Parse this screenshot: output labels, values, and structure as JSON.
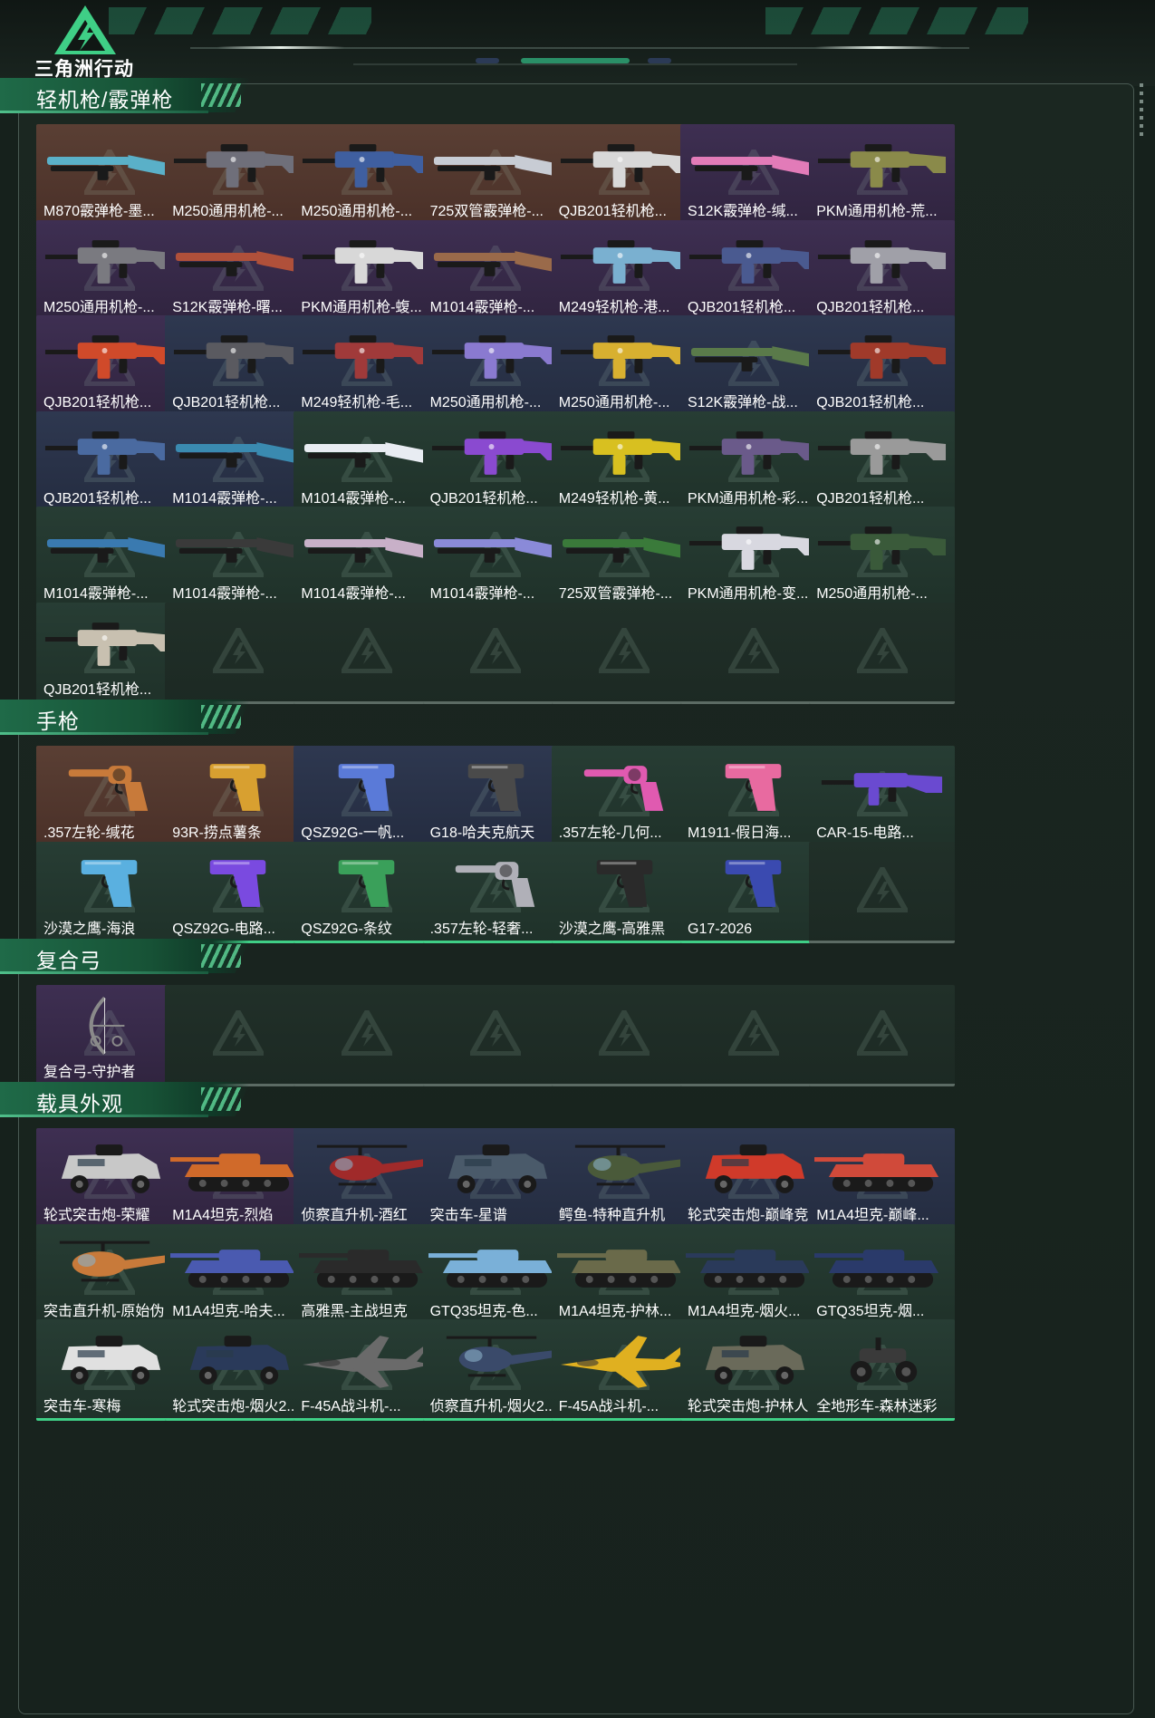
{
  "header": {
    "logo_text": "三角洲行动"
  },
  "sections": [
    {
      "title": "轻机枪/霰弹枪",
      "items": [
        {
          "name": "M870霰弹枪-墨...",
          "rarity": "orange",
          "icon": "shotgun-icon",
          "color": "#5ab0c8"
        },
        {
          "name": "M250通用机枪-...",
          "rarity": "orange",
          "icon": "machine-gun-icon",
          "color": "#6f6f7a"
        },
        {
          "name": "M250通用机枪-...",
          "rarity": "orange",
          "icon": "machine-gun-icon",
          "color": "#3f5fa0"
        },
        {
          "name": "725双管霰弹枪-...",
          "rarity": "orange",
          "icon": "shotgun-icon",
          "color": "#c8ccd4"
        },
        {
          "name": "QJB201轻机枪...",
          "rarity": "orange",
          "icon": "machine-gun-icon",
          "color": "#d8d8d8"
        },
        {
          "name": "S12K霰弹枪-缄...",
          "rarity": "purple",
          "icon": "shotgun-icon",
          "color": "#e27bb8"
        },
        {
          "name": "PKM通用机枪-荒...",
          "rarity": "purple",
          "icon": "machine-gun-icon",
          "color": "#8a8a4a"
        },
        {
          "name": "M250通用机枪-...",
          "rarity": "purple",
          "icon": "machine-gun-icon",
          "color": "#7a7a80"
        },
        {
          "name": "S12K霰弹枪-曙...",
          "rarity": "purple",
          "icon": "shotgun-icon",
          "color": "#b0503a"
        },
        {
          "name": "PKM通用机枪-蝮...",
          "rarity": "purple",
          "icon": "machine-gun-icon",
          "color": "#d8d8d8"
        },
        {
          "name": "M1014霰弹枪-...",
          "rarity": "purple",
          "icon": "shotgun-icon",
          "color": "#9a6a4a"
        },
        {
          "name": "M249轻机枪-港...",
          "rarity": "purple",
          "icon": "machine-gun-icon",
          "color": "#7ab0d0"
        },
        {
          "name": "QJB201轻机枪...",
          "rarity": "purple",
          "icon": "machine-gun-icon",
          "color": "#4a5a90"
        },
        {
          "name": "QJB201轻机枪...",
          "rarity": "purple",
          "icon": "machine-gun-icon",
          "color": "#a0a0a8"
        },
        {
          "name": "QJB201轻机枪...",
          "rarity": "purple",
          "icon": "machine-gun-icon",
          "color": "#d04a2a"
        },
        {
          "name": "QJB201轻机枪...",
          "rarity": "blue",
          "icon": "machine-gun-icon",
          "color": "#5a5a60"
        },
        {
          "name": "M249轻机枪-毛...",
          "rarity": "blue",
          "icon": "machine-gun-icon",
          "color": "#a03a3a"
        },
        {
          "name": "M250通用机枪-...",
          "rarity": "blue",
          "icon": "machine-gun-icon",
          "color": "#8a7ad0"
        },
        {
          "name": "M250通用机枪-...",
          "rarity": "blue",
          "icon": "machine-gun-icon",
          "color": "#d8b030"
        },
        {
          "name": "S12K霰弹枪-战...",
          "rarity": "blue",
          "icon": "shotgun-icon",
          "color": "#5a7a4a"
        },
        {
          "name": "QJB201轻机枪...",
          "rarity": "blue",
          "icon": "machine-gun-icon",
          "color": "#a03a2a"
        },
        {
          "name": "QJB201轻机枪...",
          "rarity": "blue",
          "icon": "machine-gun-icon",
          "color": "#4a6aa0"
        },
        {
          "name": "M1014霰弹枪-...",
          "rarity": "blue",
          "icon": "shotgun-icon",
          "color": "#3a8ab0"
        },
        {
          "name": "M1014霰弹枪-...",
          "rarity": "green",
          "icon": "shotgun-icon",
          "color": "#e8ecf2"
        },
        {
          "name": "QJB201轻机枪...",
          "rarity": "green",
          "icon": "machine-gun-icon",
          "color": "#8a4ad0"
        },
        {
          "name": "M249轻机枪-黄...",
          "rarity": "green",
          "icon": "machine-gun-icon",
          "color": "#d8c020"
        },
        {
          "name": "PKM通用机枪-彩...",
          "rarity": "green",
          "icon": "machine-gun-icon",
          "color": "#6a5a8a"
        },
        {
          "name": "QJB201轻机枪...",
          "rarity": "green",
          "icon": "machine-gun-icon",
          "color": "#9a9a9a"
        },
        {
          "name": "M1014霰弹枪-...",
          "rarity": "green",
          "icon": "shotgun-icon",
          "color": "#3a7ab0"
        },
        {
          "name": "M1014霰弹枪-...",
          "rarity": "green",
          "icon": "shotgun-icon",
          "color": "#3a3a3a"
        },
        {
          "name": "M1014霰弹枪-...",
          "rarity": "green",
          "icon": "shotgun-icon",
          "color": "#c8b0c8"
        },
        {
          "name": "M1014霰弹枪-...",
          "rarity": "green",
          "icon": "shotgun-icon",
          "color": "#8a8ad8"
        },
        {
          "name": "725双管霰弹枪-...",
          "rarity": "green",
          "icon": "shotgun-icon",
          "color": "#3a7a3a"
        },
        {
          "name": "PKM通用机枪-变...",
          "rarity": "green",
          "icon": "machine-gun-icon",
          "color": "#d8d8e0"
        },
        {
          "name": "M250通用机枪-...",
          "rarity": "green",
          "icon": "machine-gun-icon",
          "color": "#3a5a3a"
        },
        {
          "name": "QJB201轻机枪...",
          "rarity": "green",
          "icon": "machine-gun-icon",
          "color": "#c8c0b0"
        },
        {
          "name": "",
          "rarity": "empty"
        },
        {
          "name": "",
          "rarity": "empty"
        },
        {
          "name": "",
          "rarity": "empty"
        },
        {
          "name": "",
          "rarity": "empty"
        },
        {
          "name": "",
          "rarity": "empty"
        },
        {
          "name": "",
          "rarity": "empty"
        }
      ]
    },
    {
      "title": "手枪",
      "items": [
        {
          "name": ".357左轮-缄花",
          "rarity": "orange",
          "icon": "revolver-icon",
          "color": "#c87a3a"
        },
        {
          "name": "93R-捞点薯条",
          "rarity": "orange",
          "icon": "pistol-icon",
          "color": "#d8a030"
        },
        {
          "name": "QSZ92G-一帆...",
          "rarity": "blue",
          "icon": "pistol-icon",
          "color": "#5a7ad8"
        },
        {
          "name": "G18-哈夫克航天",
          "rarity": "blue",
          "icon": "pistol-icon",
          "color": "#4a4a4a"
        },
        {
          "name": ".357左轮-几何...",
          "rarity": "green",
          "icon": "revolver-icon",
          "color": "#e05ab0"
        },
        {
          "name": "M1911-假日海...",
          "rarity": "green",
          "icon": "pistol-icon",
          "color": "#e86aa0"
        },
        {
          "name": "CAR-15-电路...",
          "rarity": "green",
          "icon": "rifle-icon",
          "color": "#6a4ad0"
        },
        {
          "name": "沙漠之鹰-海浪",
          "rarity": "green",
          "icon": "pistol-icon",
          "color": "#5ab0e0"
        },
        {
          "name": "QSZ92G-电路...",
          "rarity": "green",
          "icon": "pistol-icon",
          "color": "#7a4ae0"
        },
        {
          "name": "QSZ92G-条纹",
          "rarity": "green",
          "icon": "pistol-icon",
          "color": "#3aa05a"
        },
        {
          "name": ".357左轮-轻奢...",
          "rarity": "green",
          "icon": "revolver-icon",
          "color": "#b0b0b8"
        },
        {
          "name": "沙漠之鹰-高雅黑",
          "rarity": "green",
          "icon": "pistol-icon",
          "color": "#2a2a2a"
        },
        {
          "name": "G17-2026",
          "rarity": "green",
          "icon": "pistol-icon",
          "color": "#3a4ab0"
        },
        {
          "name": "",
          "rarity": "empty"
        }
      ]
    },
    {
      "title": "复合弓",
      "items": [
        {
          "name": "复合弓-守护者",
          "rarity": "purple",
          "icon": "bow-icon",
          "color": "#8a8a8a"
        },
        {
          "name": "",
          "rarity": "empty"
        },
        {
          "name": "",
          "rarity": "empty"
        },
        {
          "name": "",
          "rarity": "empty"
        },
        {
          "name": "",
          "rarity": "empty"
        },
        {
          "name": "",
          "rarity": "empty"
        },
        {
          "name": "",
          "rarity": "empty"
        }
      ]
    },
    {
      "title": "载具外观",
      "items": [
        {
          "name": "轮式突击炮-荣耀",
          "rarity": "purple",
          "icon": "armored-car-icon",
          "color": "#c8c8c8"
        },
        {
          "name": "M1A4坦克-烈焰",
          "rarity": "purple",
          "icon": "tank-icon",
          "color": "#d06a2a"
        },
        {
          "name": "侦察直升机-酒红",
          "rarity": "blue",
          "icon": "helicopter-icon",
          "color": "#a02a2a"
        },
        {
          "name": "突击车-星谱",
          "rarity": "blue",
          "icon": "armored-car-icon",
          "color": "#4a5a6a"
        },
        {
          "name": "鳄鱼-特种直升机",
          "rarity": "blue",
          "icon": "helicopter-icon",
          "color": "#4a5a3a"
        },
        {
          "name": "轮式突击炮-巅峰竞...",
          "rarity": "blue",
          "icon": "armored-car-icon",
          "color": "#d03a2a"
        },
        {
          "name": "M1A4坦克-巅峰...",
          "rarity": "blue",
          "icon": "tank-icon",
          "color": "#d04a3a"
        },
        {
          "name": "突击直升机-原始伪...",
          "rarity": "green",
          "icon": "helicopter-icon",
          "color": "#c87a3a"
        },
        {
          "name": "M1A4坦克-哈夫...",
          "rarity": "green",
          "icon": "tank-icon",
          "color": "#4a5ab0"
        },
        {
          "name": "高雅黑-主战坦克",
          "rarity": "green",
          "icon": "tank-icon",
          "color": "#2a2a2a"
        },
        {
          "name": "GTQ35坦克-色...",
          "rarity": "green",
          "icon": "tank-icon",
          "color": "#7ab0d8"
        },
        {
          "name": "M1A4坦克-护林...",
          "rarity": "green",
          "icon": "tank-icon",
          "color": "#6a6a4a"
        },
        {
          "name": "M1A4坦克-烟火...",
          "rarity": "green",
          "icon": "tank-icon",
          "color": "#2a3a5a"
        },
        {
          "name": "GTQ35坦克-烟...",
          "rarity": "green",
          "icon": "tank-icon",
          "color": "#2a3a6a"
        },
        {
          "name": "突击车-寒梅",
          "rarity": "green",
          "icon": "armored-car-icon",
          "color": "#e0e0e0"
        },
        {
          "name": "轮式突击炮-烟火2...",
          "rarity": "green",
          "icon": "armored-car-icon",
          "color": "#2a3a5a"
        },
        {
          "name": "F-45A战斗机-...",
          "rarity": "green",
          "icon": "jet-icon",
          "color": "#6a6a6a"
        },
        {
          "name": "侦察直升机-烟火2...",
          "rarity": "green",
          "icon": "helicopter-icon",
          "color": "#3a4a6a"
        },
        {
          "name": "F-45A战斗机-...",
          "rarity": "green",
          "icon": "jet-icon",
          "color": "#e0b020"
        },
        {
          "name": "轮式突击炮-护林人",
          "rarity": "green",
          "icon": "armored-car-icon",
          "color": "#6a6a5a"
        },
        {
          "name": "全地形车-森林迷彩",
          "rarity": "green",
          "icon": "atv-icon",
          "color": "#3a3a3a"
        }
      ]
    }
  ]
}
